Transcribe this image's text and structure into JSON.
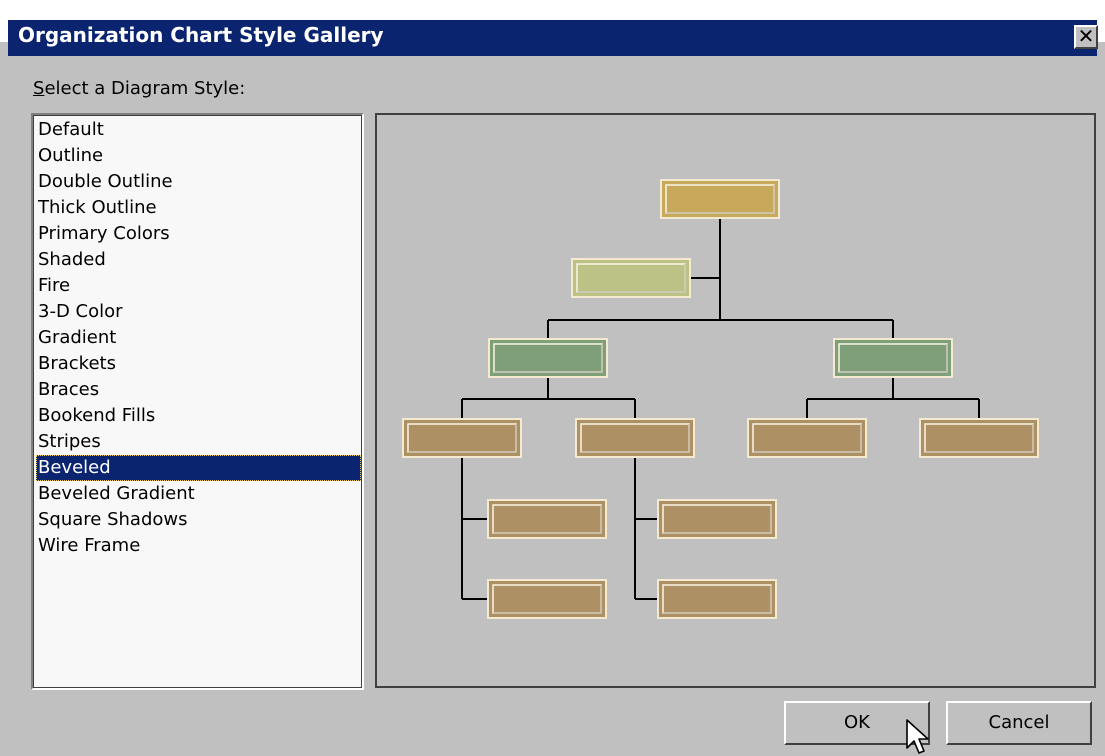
{
  "window": {
    "title": "Organization Chart Style Gallery",
    "close_glyph": "✕"
  },
  "prompt": {
    "underline_char": "S",
    "rest": "elect a Diagram Style:"
  },
  "styles": {
    "items": [
      "Default",
      "Outline",
      "Double Outline",
      "Thick Outline",
      "Primary Colors",
      "Shaded",
      "Fire",
      "3-D Color",
      "Gradient",
      "Brackets",
      "Braces",
      "Bookend Fills",
      "Stripes",
      "Beveled",
      "Beveled Gradient",
      "Square Shadows",
      "Wire Frame"
    ],
    "selected": "Beveled"
  },
  "preview": {
    "colors": {
      "top": "#c8a95c",
      "assistant": "#bcc185",
      "manager": "#7f9f78",
      "staff": "#ad9063",
      "line": "#000000"
    }
  },
  "buttons": {
    "ok": "OK",
    "cancel": "Cancel"
  }
}
